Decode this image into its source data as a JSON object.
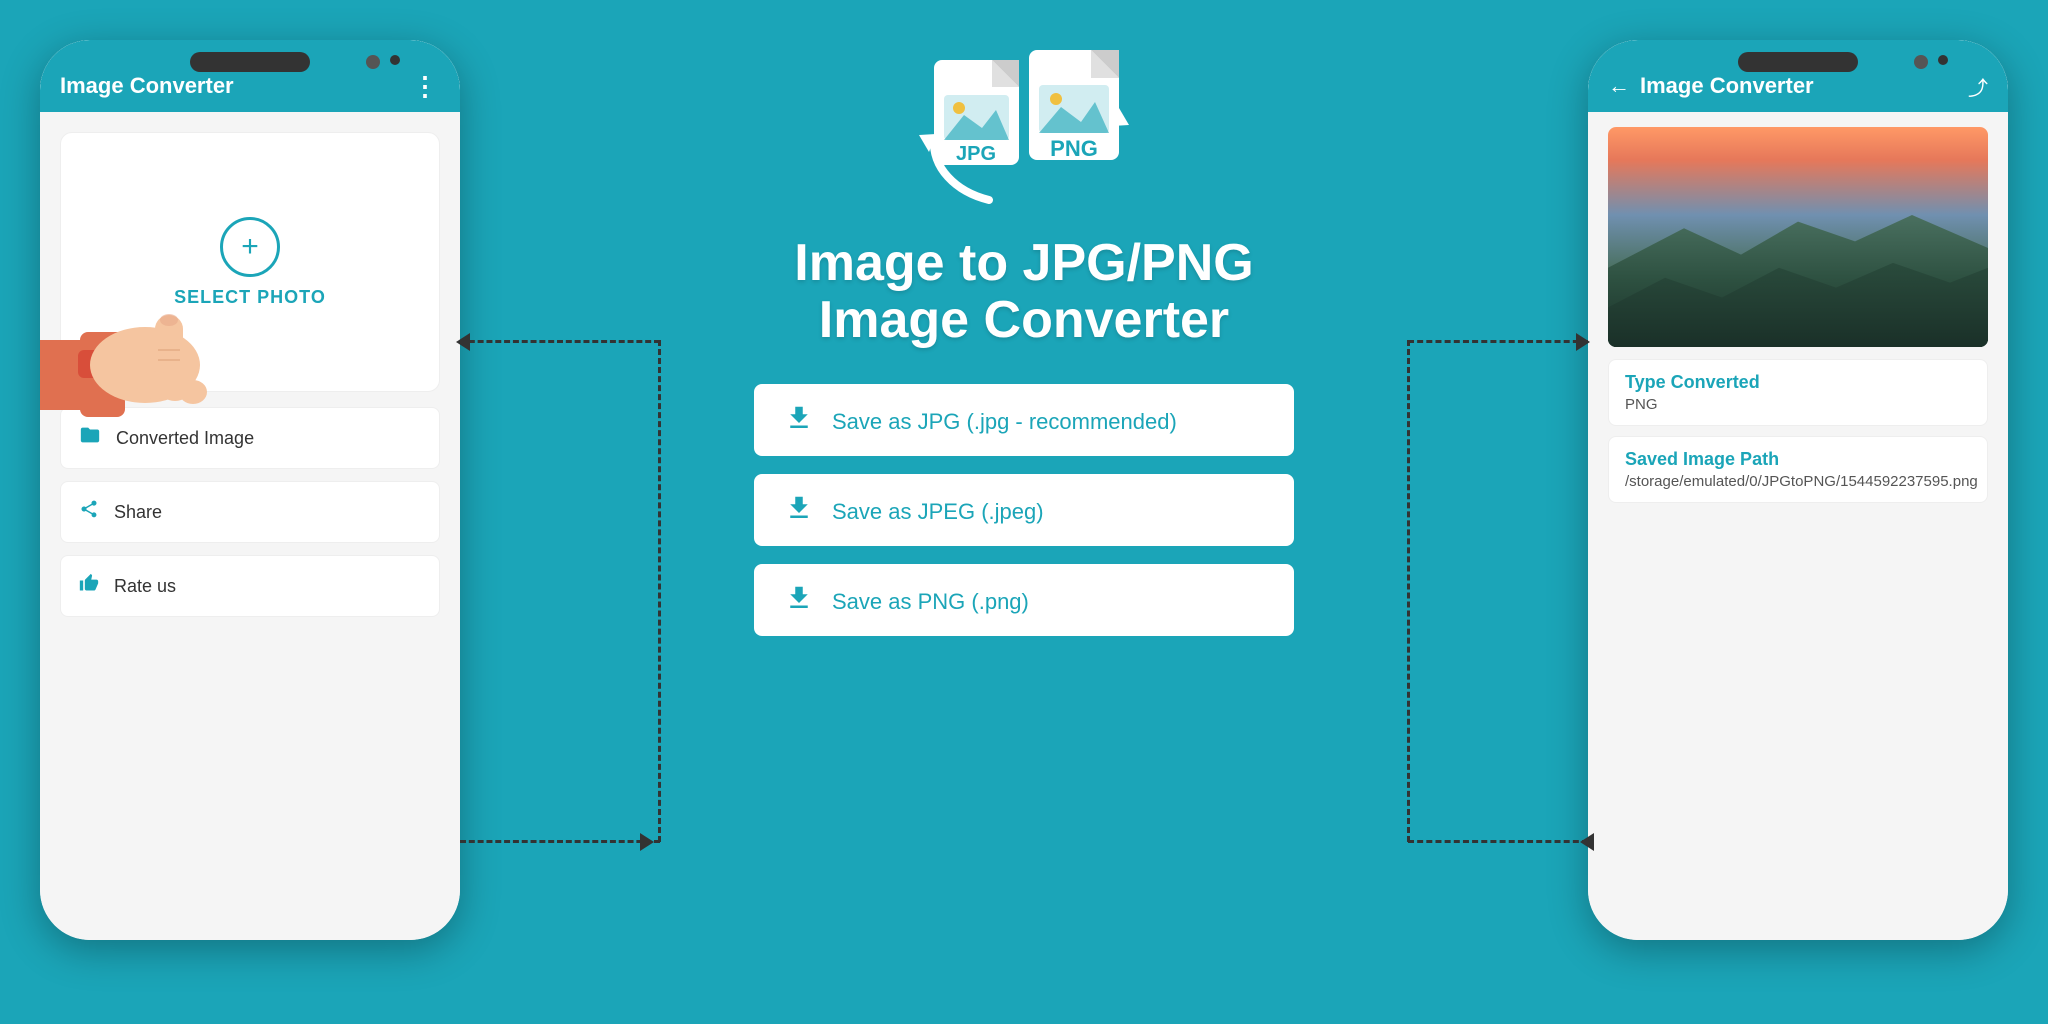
{
  "app": {
    "background_color": "#1ba5b8",
    "accent_color": "#1ba5b8"
  },
  "center": {
    "title_line1": "Image to JPG/PNG",
    "title_line2": "Image Converter",
    "buttons": [
      {
        "id": "save-jpg",
        "label": "Save as JPG",
        "suffix": " (.jpg - recommended)"
      },
      {
        "id": "save-jpeg",
        "label": "Save as JPEG",
        "suffix": " (.jpeg)"
      },
      {
        "id": "save-png",
        "label": "Save as PNG",
        "suffix": " (.png)"
      }
    ]
  },
  "phone_left": {
    "app_bar_title": "Image Converter",
    "menu_icon": "⋮",
    "select_photo_label": "SELECT PHOTO",
    "menu_items": [
      {
        "id": "converted-image",
        "icon": "folder",
        "label": "Converted Image"
      },
      {
        "id": "share",
        "icon": "share",
        "label": "Share"
      },
      {
        "id": "rate-us",
        "icon": "thumb-up",
        "label": "Rate us"
      }
    ]
  },
  "phone_right": {
    "app_bar_title": "Image Converter",
    "back_icon": "←",
    "share_icon": "⤴",
    "type_converted_label": "Type Converted",
    "type_converted_value": "PNG",
    "saved_path_label": "Saved Image Path",
    "saved_path_value": "/storage/emulated/0/JPGtoPNG/1544592237595.png"
  }
}
